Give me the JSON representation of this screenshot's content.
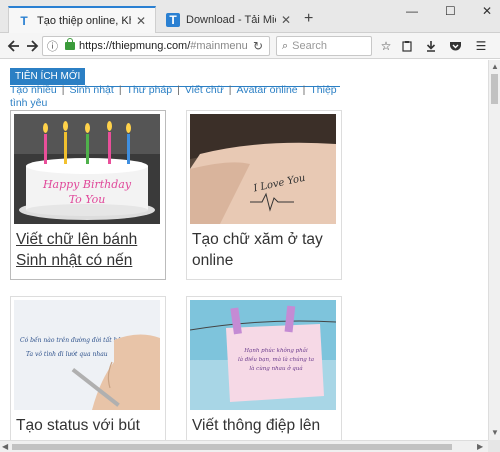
{
  "browser": {
    "tabs": [
      {
        "title": "Tạo thiệp online, Khung ả...",
        "favicon": "T",
        "active": true
      },
      {
        "title": "Download - Tải Miễn Phí ...",
        "favicon": "T",
        "active": false
      }
    ],
    "new_tab_symbol": "+",
    "window_controls": {
      "minimize": "—",
      "maximize": "☐",
      "close": "✕"
    },
    "url": {
      "host": "https://thiepmung.com/",
      "rest": "#mainmenu"
    },
    "search_placeholder": "Search"
  },
  "page": {
    "section_badge": "TIÊN ÍCH MỚI",
    "categories": [
      "Tạo nhiều",
      "Sinh nhật",
      "Thư pháp",
      "Viết chữ",
      "Avatar online",
      "Thiệp tình yêu"
    ],
    "cards": [
      {
        "caption": "Viết chữ lên bánh Sinh nhật có nến",
        "thumb_alt": "Birthday cake",
        "cake_text_1": "Happy Birthday",
        "cake_text_2": "To You"
      },
      {
        "caption": "Tạo chữ xăm ở tay online",
        "thumb_alt": "Wrist tattoo",
        "tattoo_text": "I Love You"
      },
      {
        "caption": "Tạo status với bút",
        "thumb_alt": "Hand writing",
        "note_line_1": "Có bến nào trên đường đời tất bật",
        "note_line_2": "Ta vô tình đi lướt qua nhau"
      },
      {
        "caption": "Viết thông điệp lên",
        "thumb_alt": "Hanging note",
        "message_line_1": "Hạnh phúc không phải",
        "message_line_2": "là điều bạn, mà là chúng ta",
        "message_line_3": "là cùng nhau ở quá"
      }
    ]
  },
  "colors": {
    "accent": "#2b7fc4",
    "tab_highlight": "#2a80d2"
  }
}
